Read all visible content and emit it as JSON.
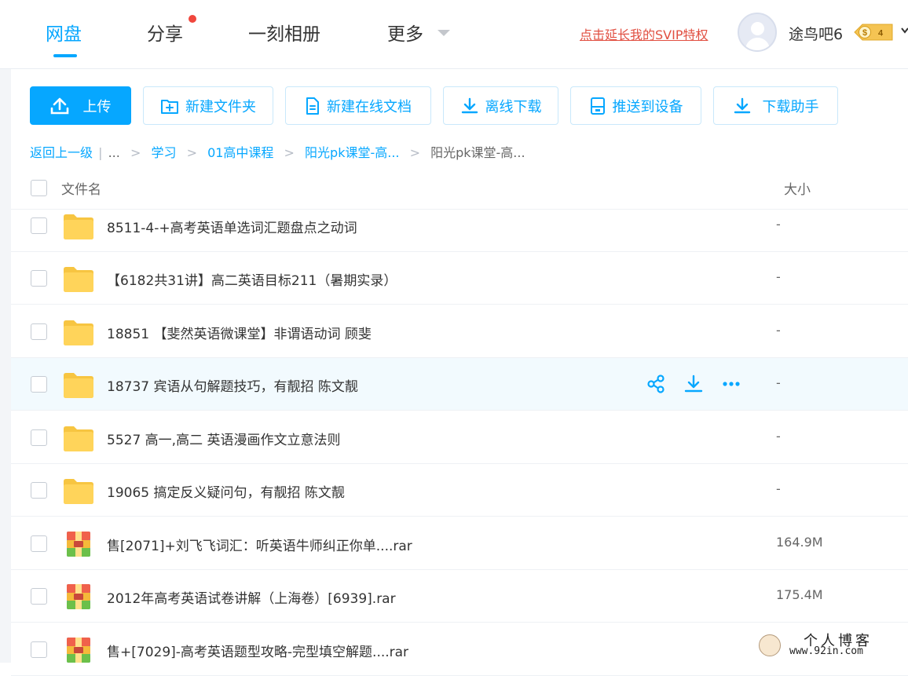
{
  "nav": {
    "items": [
      "网盘",
      "分享",
      "一刻相册",
      "更多"
    ],
    "active_index": 0,
    "share_has_dot": true,
    "svip_link": "点击延长我的SVIP特权",
    "username": "途鸟吧6",
    "vip_level": "4",
    "vip_symbol": "$"
  },
  "toolbar": {
    "upload": "上传",
    "new_folder": "新建文件夹",
    "new_doc": "新建在线文档",
    "offline_download": "离线下载",
    "push_device": "推送到设备",
    "download_helper": "下载助手"
  },
  "breadcrumb": {
    "back": "返回上一级",
    "bar": "|",
    "ellipsis": "...",
    "items": [
      "学习",
      "01高中课程",
      "阳光pk课堂-高..."
    ],
    "current": "阳光pk课堂-高...",
    "separator": ">"
  },
  "table": {
    "columns": {
      "name": "文件名",
      "size": "大小"
    },
    "rows": [
      {
        "type": "folder",
        "name": "8511-4-+高考英语单选词汇题盘点之动词",
        "size": "-"
      },
      {
        "type": "folder",
        "name": "【6182共31讲】高二英语目标211（暑期实录）",
        "size": "-"
      },
      {
        "type": "folder",
        "name": "18851 【斐然英语微课堂】非谓语动词 顾斐",
        "size": "-"
      },
      {
        "type": "folder",
        "name": "18737 宾语从句解题技巧，有靓招 陈文靓",
        "size": "-",
        "hover": true
      },
      {
        "type": "folder",
        "name": "5527 高一,高二 英语漫画作文立意法则",
        "size": "-"
      },
      {
        "type": "folder",
        "name": "19065 搞定反义疑问句，有靓招 陈文靓",
        "size": "-"
      },
      {
        "type": "rar",
        "name": "售[2071]+刘飞飞词汇：听英语牛师纠正你单....rar",
        "size": "164.9M"
      },
      {
        "type": "rar",
        "name": "2012年高考英语试卷讲解（上海卷）[6939].rar",
        "size": "175.4M"
      },
      {
        "type": "rar",
        "name": "售+[7029]-高考英语题型攻略-完型填空解题....rar",
        "size": ""
      }
    ]
  },
  "watermark": {
    "title": "个人博客",
    "url": "www.92in.com"
  },
  "colors": {
    "accent": "#06a7ff",
    "svip_red": "#e14f41",
    "folder_yellow": "#ffd45a",
    "hover_row": "#f2fafe"
  }
}
